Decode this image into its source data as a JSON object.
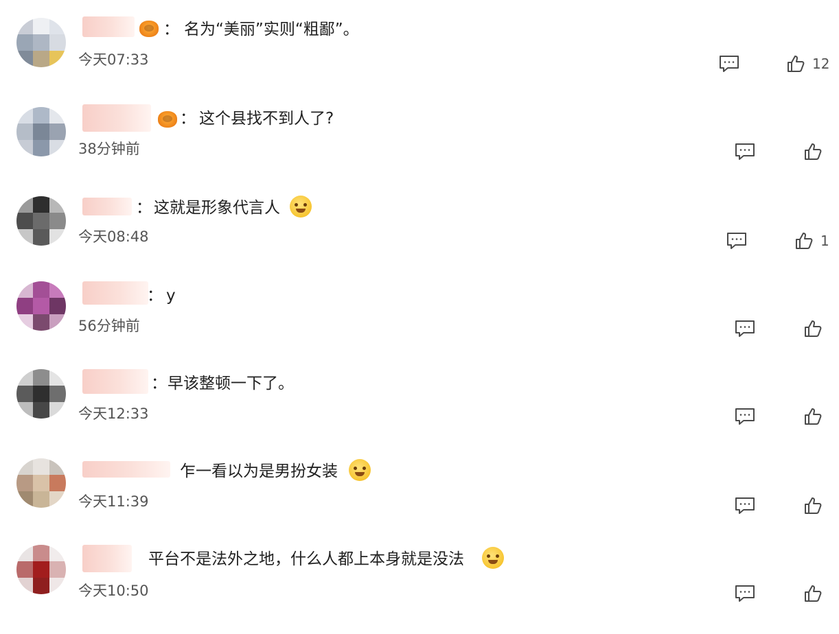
{
  "colors": {
    "text": "#222222",
    "muted": "#555555",
    "icon": "#4a4a4a",
    "badge": "#f18a1d",
    "name_blur": "#f8cfc8"
  },
  "comments": [
    {
      "separator": "：",
      "text": "名为“美丽”实则“粗鄙”。",
      "time": "今天07:33",
      "likes": "12",
      "avatar_tiles": [
        "#c9cdd6",
        "#eef0f3",
        "#dfe3ea",
        "#9aa6b5",
        "#aeb7c4",
        "#d7dbe2",
        "#808b99",
        "#b9a887",
        "#e7c45a"
      ],
      "badge": "crown-badge"
    },
    {
      "separator": "：",
      "text": "这个县找不到人了?",
      "time": "38分钟前",
      "likes": "",
      "avatar_tiles": [
        "#d8dde5",
        "#aeb9c8",
        "#e4e7ec",
        "#b5bdc8",
        "#7b8797",
        "#9aa3b1",
        "#c7ccd5",
        "#8b98aa",
        "#d9dde4"
      ],
      "badge": "crown-badge"
    },
    {
      "separator": "：",
      "text": "这就是形象代言人",
      "time": "今天08:48",
      "likes": "1",
      "avatar_tiles": [
        "#9a9a9a",
        "#2e2e2e",
        "#b8b8b8",
        "#4d4d4d",
        "#6b6b6b",
        "#8a8a8a",
        "#c7c7c7",
        "#5a5a5a",
        "#e2e2e2"
      ],
      "emoji": "crying-laugh-emoji"
    },
    {
      "separator": "：",
      "text": "y",
      "time": "56分钟前",
      "likes": "",
      "avatar_tiles": [
        "#d8b7d2",
        "#a34f96",
        "#c77bbb",
        "#8f3f82",
        "#b45aa6",
        "#6e3664",
        "#e6cde1",
        "#7b4a6e",
        "#c99fbf"
      ]
    },
    {
      "separator": "：",
      "text": "早该整顿一下了。",
      "time": "今天12:33",
      "likes": "",
      "avatar_tiles": [
        "#cfcfcf",
        "#8d8d8d",
        "#e4e4e4",
        "#5b5b5b",
        "#2f2f2f",
        "#6e6e6e",
        "#bdbdbd",
        "#474747",
        "#dadada"
      ]
    },
    {
      "separator": "",
      "text": "乍一看以为是男扮女装",
      "time": "今天11:39",
      "likes": "",
      "avatar_tiles": [
        "#d8d4cf",
        "#e7e3df",
        "#c9c3bc",
        "#b89a84",
        "#d9c2a8",
        "#c87a5d",
        "#a08a70",
        "#c9b597",
        "#e3d6c6"
      ],
      "emoji": "tongue-out-emoji"
    },
    {
      "separator": "",
      "text": "平台不是法外之地，什么人都上本身就是没法",
      "time": "今天10:50",
      "likes": "",
      "avatar_tiles": [
        "#e9e4e4",
        "#c98c8c",
        "#f1ecec",
        "#b96a6a",
        "#a21d1d",
        "#d9b2b2",
        "#e2d2d2",
        "#8f1f1f",
        "#efe7e7"
      ],
      "emoji": "worried-emoji"
    }
  ]
}
